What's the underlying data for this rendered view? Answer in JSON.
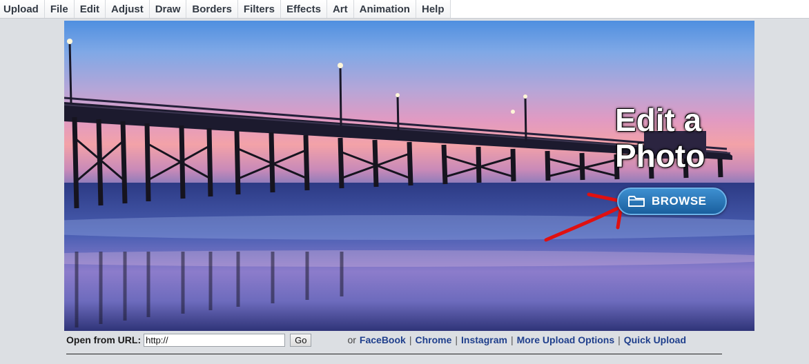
{
  "menu": {
    "items": [
      "Upload",
      "File",
      "Edit",
      "Adjust",
      "Draw",
      "Borders",
      "Filters",
      "Effects",
      "Art",
      "Animation",
      "Help"
    ]
  },
  "hero": {
    "title_line1": "Edit a",
    "title_line2": "Photo",
    "browse_label": "BROWSE",
    "browse_icon": "folder-icon",
    "annotation": "red-arrow-pointing-to-browse"
  },
  "url_row": {
    "label": "Open from URL:",
    "input_value": "http://",
    "go_label": "Go",
    "or_text": "or",
    "links": [
      "FaceBook",
      "Chrome",
      "Instagram",
      "More Upload Options",
      "Quick Upload"
    ],
    "separator": "|"
  },
  "colors": {
    "link": "#1f3f8c",
    "browse_button": "#2a78bd",
    "arrow": "#e01010"
  }
}
